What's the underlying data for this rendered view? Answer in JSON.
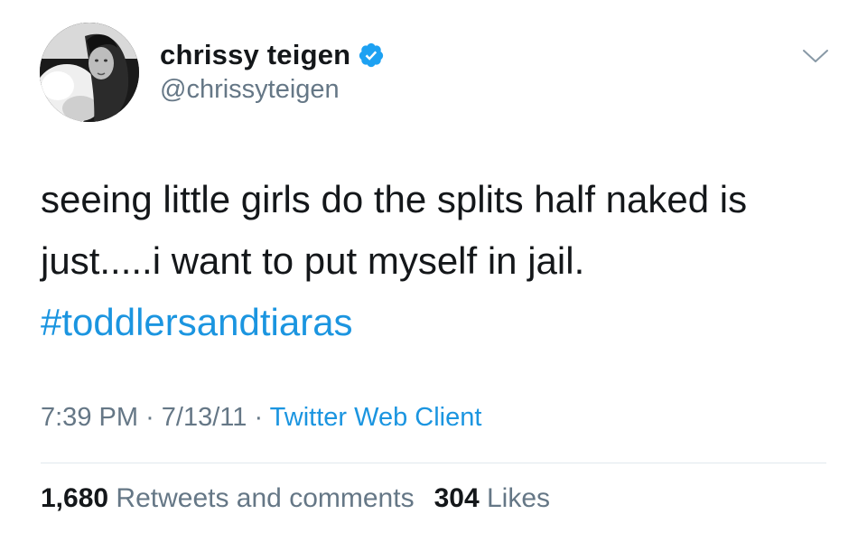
{
  "user": {
    "display_name": "chrissy teigen",
    "handle": "@chrissyteigen",
    "verified": true
  },
  "tweet": {
    "text_line1": "seeing little girls do the splits half naked is",
    "text_line2": "just.....i want to put myself in jail.",
    "hashtag": "#toddlersandtiaras"
  },
  "meta": {
    "time": "7:39 PM",
    "separator": "·",
    "date": "7/13/11",
    "source": "Twitter Web Client"
  },
  "stats": {
    "retweets_count": "1,680",
    "retweets_label": "Retweets and comments",
    "likes_count": "304",
    "likes_label": "Likes"
  },
  "colors": {
    "link": "#1b95e0",
    "secondary": "#657786",
    "text": "#14171a",
    "verified_badge": "#1da1f2"
  },
  "icons": {
    "menu": "chevron-down-icon",
    "verified": "verified-badge-icon"
  }
}
